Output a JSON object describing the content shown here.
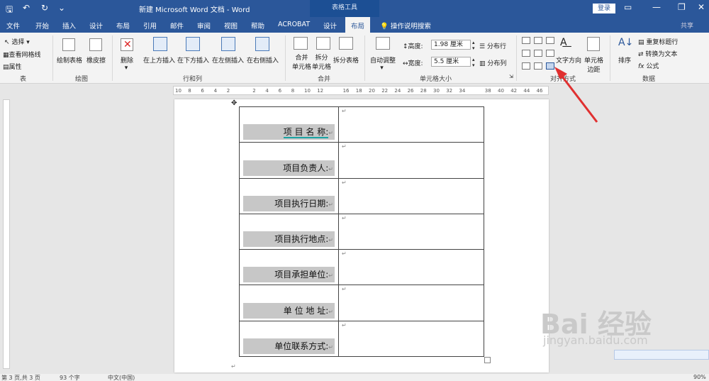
{
  "titlebar": {
    "title": "新建 Microsoft Word 文档  -  Word",
    "context_tools": "表格工具",
    "login": "登录",
    "qa_save": "🖫",
    "qa_undo": "↶",
    "qa_redo": "↻",
    "qa_more": "⌄",
    "min": "—",
    "restore": "❐",
    "close": "✕",
    "ribbon_display": "▭"
  },
  "tabs": [
    "文件",
    "开始",
    "插入",
    "设计",
    "布局",
    "引用",
    "邮件",
    "审阅",
    "视图",
    "帮助",
    "ACROBAT",
    "设计",
    "布局"
  ],
  "active_tab": "布局",
  "help_search": "操作说明搜索",
  "share": "共享",
  "ribbon": {
    "table_group": {
      "select": "选择",
      "gridlines": "查看网格线",
      "properties": "属性",
      "label": "表"
    },
    "draw_group": {
      "draw_table": "绘制表格",
      "eraser": "橡皮擦",
      "label": "绘图"
    },
    "rows_cols": {
      "delete": "删除",
      "insert_above": "在上方插入",
      "insert_below": "在下方插入",
      "insert_left": "在左侧插入",
      "insert_right": "在右侧插入",
      "label": "行和列"
    },
    "merge": {
      "merge_cells_1": "合并",
      "merge_cells_2": "单元格",
      "split_cells_1": "拆分",
      "split_cells_2": "单元格",
      "split_table": "拆分表格",
      "label": "合并"
    },
    "cell_size": {
      "autofit": "自动调整",
      "height_label": "高度:",
      "height_value": "1.98 厘米",
      "width_label": "宽度:",
      "width_value": "5.5 厘米",
      "distribute_rows": "分布行",
      "distribute_cols": "分布列",
      "label": "单元格大小"
    },
    "alignment": {
      "text_direction": "文字方向",
      "cell_margins_1": "单元格",
      "cell_margins_2": "边距",
      "label": "对齐方式"
    },
    "data": {
      "sort": "排序",
      "repeat_header": "重复标题行",
      "convert_text": "转换为文本",
      "formula": "公式",
      "label": "数据"
    }
  },
  "ruler_ticks": [
    "10",
    "8",
    "6",
    "4",
    "2",
    "",
    "2",
    "4",
    "6",
    "8",
    "10",
    "12",
    "",
    "16",
    "18",
    "20",
    "22",
    "24",
    "26",
    "28",
    "30",
    "32",
    "34",
    "",
    "38",
    "40",
    "42",
    "44",
    "46"
  ],
  "table_rows": [
    {
      "label": "项 目 名 称:"
    },
    {
      "label": "项目负责人:"
    },
    {
      "label": "项目执行日期:"
    },
    {
      "label": "项目执行地点:"
    },
    {
      "label": "项目承担单位:"
    },
    {
      "label": "单 位 地 址:"
    },
    {
      "label": "单位联系方式:"
    }
  ],
  "para_mark": "↵",
  "status": {
    "pages": "第 3 页,共 3 页",
    "words": "93 个字",
    "language": "中文(中国)",
    "zoom": "90%"
  },
  "watermark": {
    "main": "Bai 经验",
    "sub": "jingyan.baidu.com"
  },
  "colors": {
    "brand": "#2b579a",
    "arrow": "#e03030",
    "shade": "#c7c7c7"
  }
}
